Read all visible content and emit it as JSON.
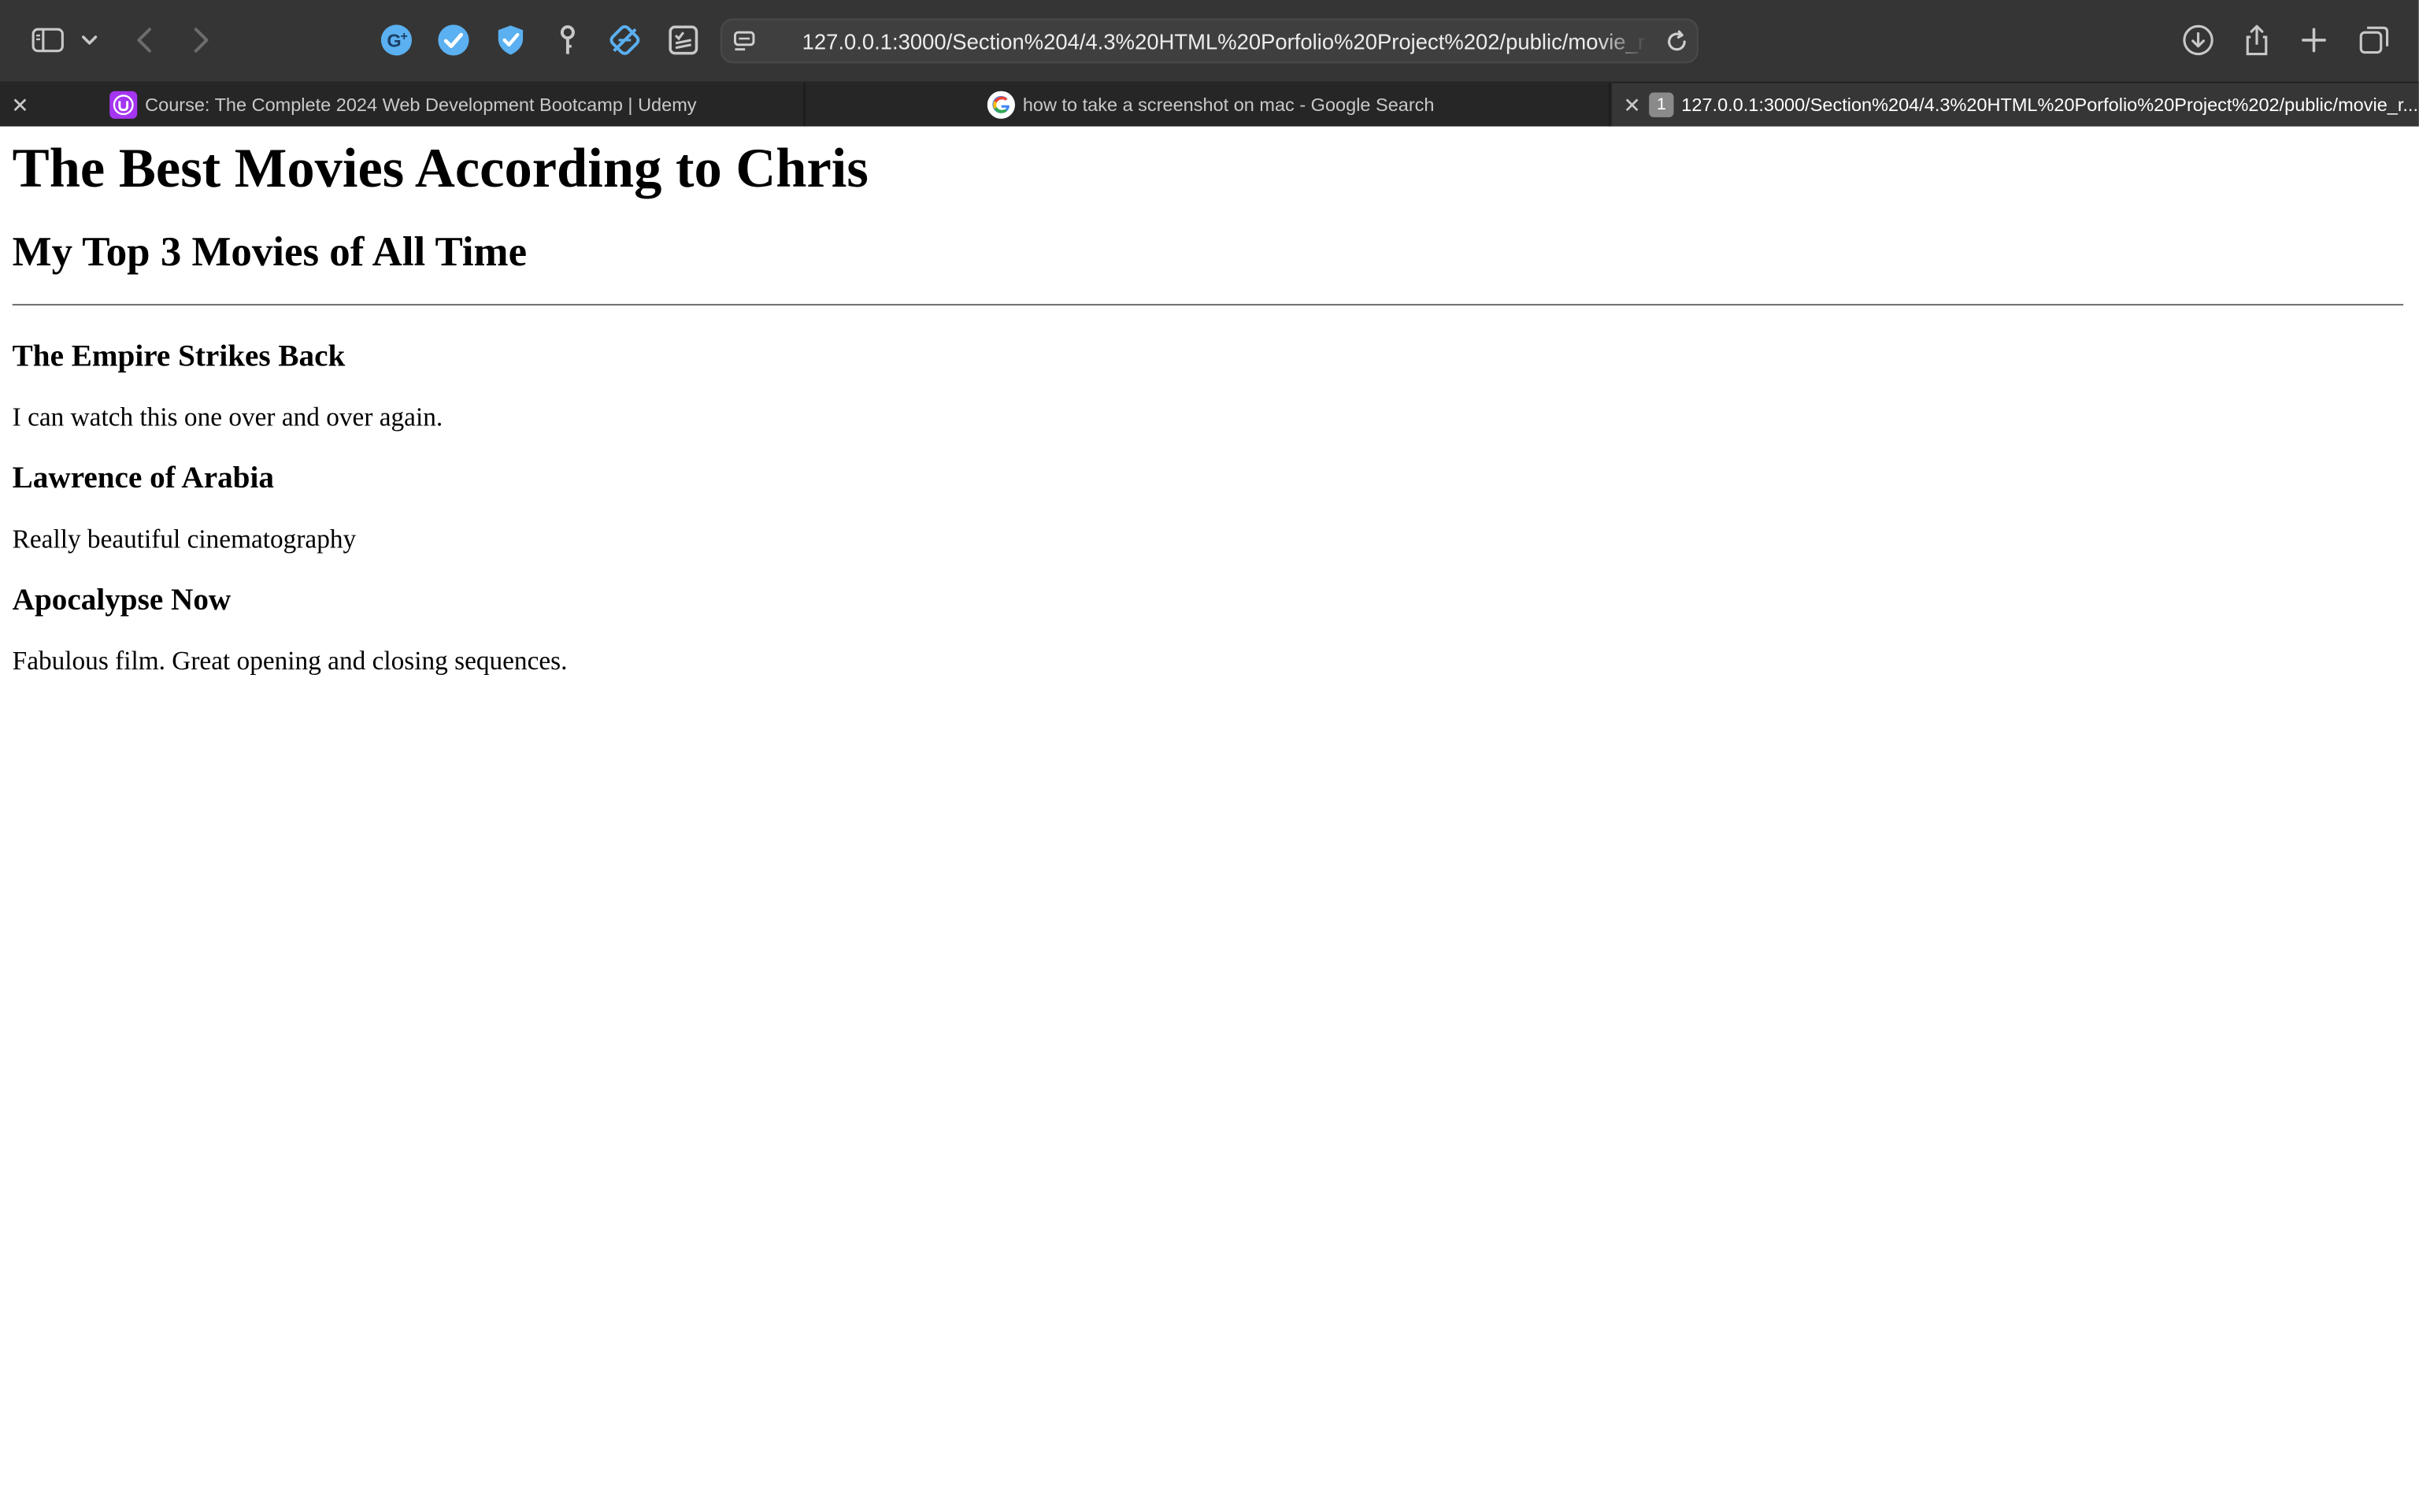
{
  "browser": {
    "url": "127.0.0.1:3000/Section%204/4.3%20HTML%20Porfolio%20Project%202/public/movie_ra",
    "tabs": [
      {
        "title": "Course: The Complete 2024 Web Development Bootcamp | Udemy",
        "active": false
      },
      {
        "title": "how to take a screenshot on mac - Google Search",
        "active": false
      },
      {
        "title": "127.0.0.1:3000/Section%204/4.3%20HTML%20Porfolio%20Project%202/public/movie_r...",
        "active": true,
        "badge": "1"
      }
    ],
    "colors": {
      "toolbar_bg": "#353535",
      "tab_bar_bg": "#262626",
      "active_tab_bg": "#363636",
      "extension_blue": "#5ab0f0",
      "udemy_purple": "#a435f0"
    }
  },
  "page": {
    "heading": "The Best Movies According to Chris",
    "subheading": "My Top 3 Movies of All Time",
    "movies": [
      {
        "title": "The Empire Strikes Back",
        "comment": "I can watch this one over and over again."
      },
      {
        "title": "Lawrence of Arabia",
        "comment": "Really beautiful cinematography"
      },
      {
        "title": "Apocalypse Now",
        "comment": "Fabulous film. Great opening and closing sequences."
      }
    ]
  }
}
